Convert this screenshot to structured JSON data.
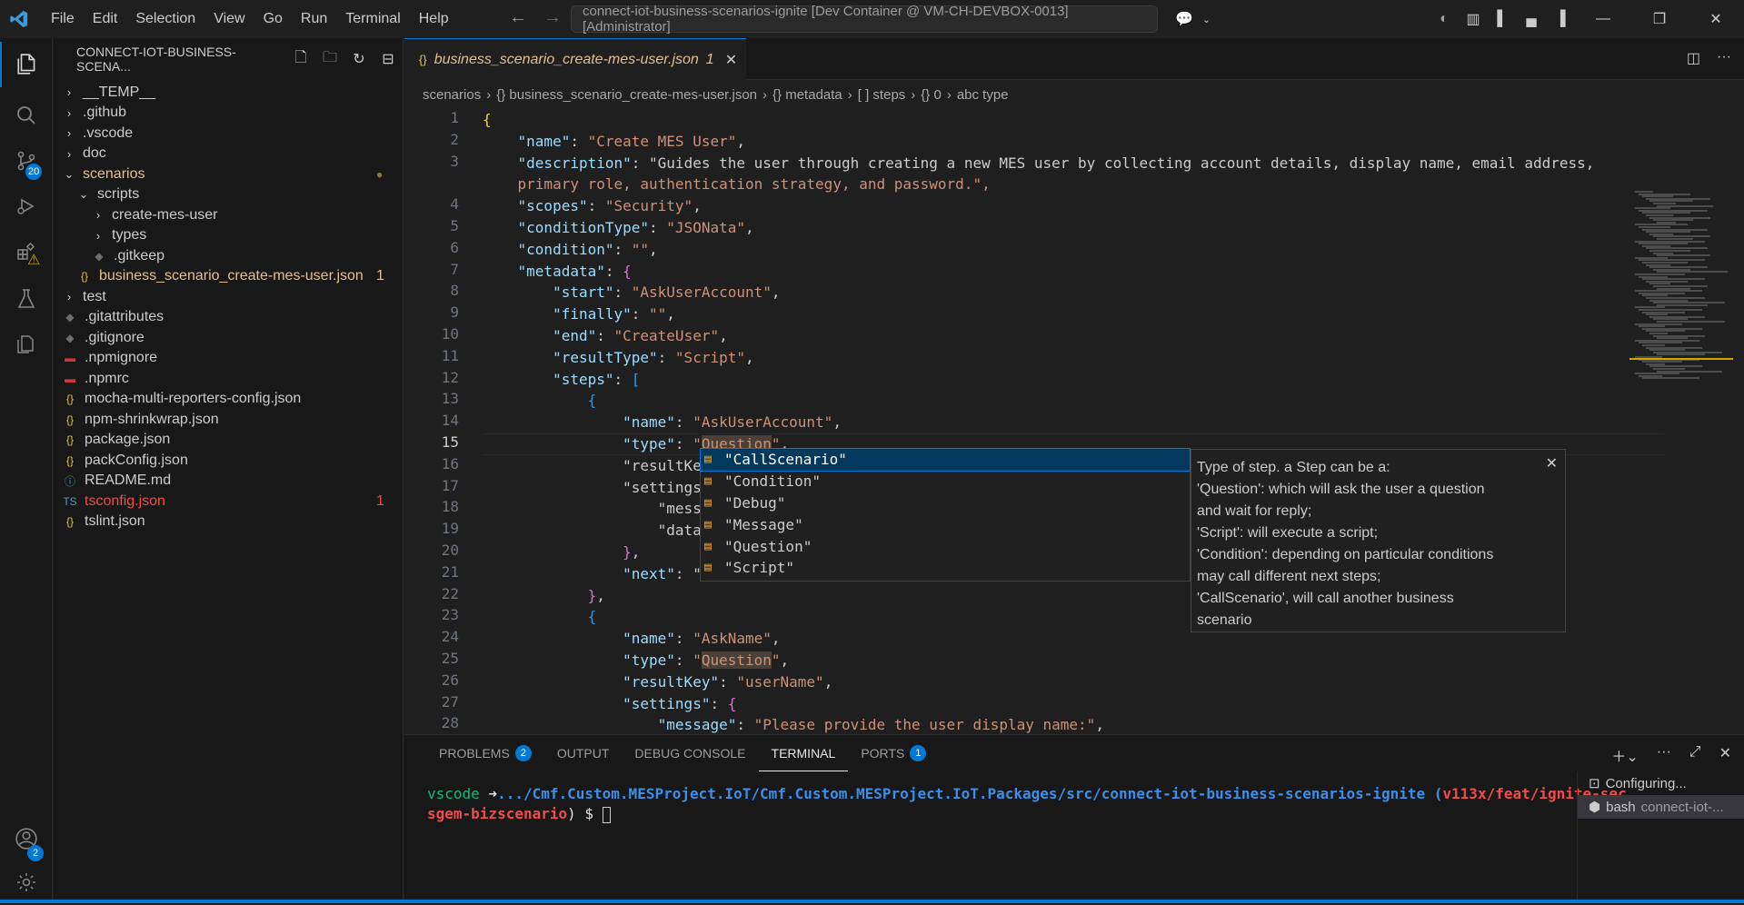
{
  "titlebar": {
    "menu": [
      "File",
      "Edit",
      "Selection",
      "View",
      "Go",
      "Run",
      "Terminal",
      "Help"
    ],
    "command_center": "connect-iot-business-scenarios-ignite [Dev Container @ VM-CH-DEVBOX-0013] [Administrator]"
  },
  "activity": {
    "scm_badge": "20",
    "accounts_badge": "2"
  },
  "explorer": {
    "title": "CONNECT-IOT-BUSINESS-SCENA...",
    "items": [
      {
        "label": "__TEMP__",
        "indent": 0,
        "type": "folder",
        "color": "#cccccc"
      },
      {
        "label": ".github",
        "indent": 0,
        "type": "folder",
        "color": "#cccccc"
      },
      {
        "label": ".vscode",
        "indent": 0,
        "type": "folder",
        "color": "#cccccc"
      },
      {
        "label": "doc",
        "indent": 0,
        "type": "folder",
        "color": "#cccccc"
      },
      {
        "label": "scenarios",
        "indent": 0,
        "type": "folder-open",
        "color": "#e2c08d",
        "dot": true
      },
      {
        "label": "scripts",
        "indent": 1,
        "type": "folder-open",
        "color": "#cccccc"
      },
      {
        "label": "create-mes-user",
        "indent": 2,
        "type": "folder",
        "color": "#cccccc"
      },
      {
        "label": "types",
        "indent": 2,
        "type": "folder",
        "color": "#cccccc"
      },
      {
        "label": ".gitkeep",
        "indent": 2,
        "type": "git",
        "color": "#cccccc"
      },
      {
        "label": "business_scenario_create-mes-user.json",
        "indent": 1,
        "type": "json",
        "color": "#e2c08d",
        "count": "1"
      },
      {
        "label": "test",
        "indent": 0,
        "type": "folder",
        "color": "#cccccc"
      },
      {
        "label": ".gitattributes",
        "indent": 0,
        "type": "git",
        "color": "#cccccc"
      },
      {
        "label": ".gitignore",
        "indent": 0,
        "type": "git",
        "color": "#cccccc"
      },
      {
        "label": ".npmignore",
        "indent": 0,
        "type": "npm",
        "color": "#cccccc"
      },
      {
        "label": ".npmrc",
        "indent": 0,
        "type": "npm",
        "color": "#cccccc"
      },
      {
        "label": "mocha-multi-reporters-config.json",
        "indent": 0,
        "type": "json",
        "color": "#cccccc"
      },
      {
        "label": "npm-shrinkwrap.json",
        "indent": 0,
        "type": "json",
        "color": "#cccccc"
      },
      {
        "label": "package.json",
        "indent": 0,
        "type": "json",
        "color": "#cccccc"
      },
      {
        "label": "packConfig.json",
        "indent": 0,
        "type": "json",
        "color": "#cccccc"
      },
      {
        "label": "README.md",
        "indent": 0,
        "type": "info",
        "color": "#cccccc"
      },
      {
        "label": "tsconfig.json",
        "indent": 0,
        "type": "ts",
        "color": "#f14c4c",
        "count": "1"
      },
      {
        "label": "tslint.json",
        "indent": 0,
        "type": "json",
        "color": "#cccccc"
      }
    ]
  },
  "tab": {
    "label": "business_scenario_create-mes-user.json",
    "count": "1"
  },
  "breadcrumbs": [
    "scenarios",
    "{} business_scenario_create-mes-user.json",
    "{} metadata",
    "[ ] steps",
    "{} 0",
    "abc type"
  ],
  "code": {
    "line_numbers": [
      "1",
      "2",
      "3",
      "",
      "4",
      "5",
      "6",
      "7",
      "8",
      "9",
      "10",
      "11",
      "12",
      "13",
      "14",
      "15",
      "16",
      "17",
      "18",
      "19",
      "20",
      "21",
      "22",
      "23",
      "24",
      "25",
      "26",
      "27",
      "28"
    ],
    "lines": [
      "{",
      "    \"name\": \"Create MES User\",",
      "    \"description\": \"Guides the user through creating a new MES user by collecting account details, display name, email address,",
      "    primary role, authentication strategy, and password.\",",
      "    \"scopes\": \"Security\",",
      "    \"conditionType\": \"JSONata\",",
      "    \"condition\": \"\",",
      "    \"metadata\": {",
      "        \"start\": \"AskUserAccount\",",
      "        \"finally\": \"\",",
      "        \"end\": \"CreateUser\",",
      "        \"resultType\": \"Script\",",
      "        \"steps\": [",
      "            {",
      "                \"name\": \"AskUserAccount\",",
      "                \"type\": \"Question\",",
      "                \"resultKe",
      "                \"settings",
      "                    \"mess",
      "                    \"data",
      "                },",
      "                \"next\": \"",
      "            },",
      "            {",
      "                \"name\": \"AskName\",",
      "                \"type\": \"Question\",",
      "                \"resultKey\": \"userName\",",
      "                \"settings\": {",
      "                    \"message\": \"Please provide the user display name:\","
    ]
  },
  "suggest": {
    "items": [
      "\"CallScenario\"",
      "\"Condition\"",
      "\"Debug\"",
      "\"Message\"",
      "\"Question\"",
      "\"Script\""
    ],
    "doc": [
      "Type of step. a Step can be a:",
      "'Question': which will ask the user a question",
      "and wait for reply;",
      "'Script': will execute a script;",
      "'Condition': depending on particular conditions",
      "may call different next steps;",
      "'CallScenario', will call another business",
      "scenario"
    ]
  },
  "panel": {
    "tabs": [
      {
        "label": "PROBLEMS",
        "badge": "2"
      },
      {
        "label": "OUTPUT",
        "badge": ""
      },
      {
        "label": "DEBUG CONSOLE",
        "badge": ""
      },
      {
        "label": "TERMINAL",
        "badge": ""
      },
      {
        "label": "PORTS",
        "badge": "1"
      }
    ],
    "terminal": {
      "prefix": "vscode",
      "arrow": " ➜",
      "path": ".../Cmf.Custom.MESProject.IoT/Cmf.Custom.MESProject.IoT.Packages/src/connect-iot-business-scenarios-ignite",
      "branch_open": " (",
      "branch": "v113x/feat/ignite-sec",
      "branch2": "sgem-bizscenario",
      "branch_close": ") $ "
    },
    "terminal_list": [
      {
        "label": "Configuring...",
        "sub": ""
      },
      {
        "label": "bash",
        "sub": "connect-iot-..."
      }
    ]
  },
  "colors": {
    "accent": "#0078d4",
    "modified": "#e2c08d",
    "error": "#f14c4c",
    "string": "#ce9178",
    "key": "#9cdcfe"
  }
}
